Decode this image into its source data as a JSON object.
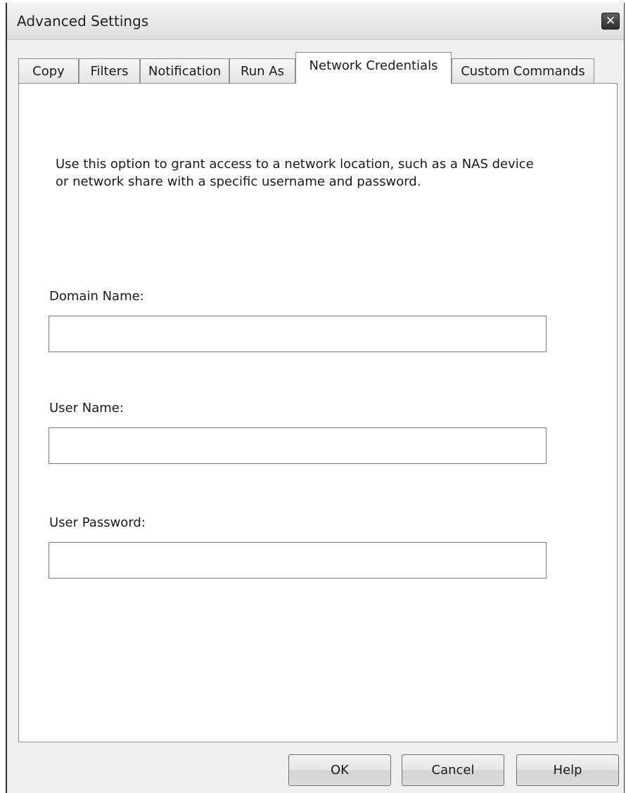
{
  "window": {
    "title": "Advanced Settings",
    "close_icon": "✕"
  },
  "tabs": [
    {
      "label": "Copy",
      "active": false
    },
    {
      "label": "Filters",
      "active": false
    },
    {
      "label": "Notification",
      "active": false
    },
    {
      "label": "Run As",
      "active": false
    },
    {
      "label": "Network Credentials",
      "active": true
    },
    {
      "label": "Custom Commands",
      "active": false
    }
  ],
  "panel": {
    "description": "Use this option to grant access to a network location, such as a NAS device or network share with a specific username and password.",
    "fields": {
      "domain": {
        "label": "Domain Name:",
        "value": ""
      },
      "user": {
        "label": "User Name:",
        "value": ""
      },
      "password": {
        "label": "User Password:",
        "value": ""
      }
    }
  },
  "buttons": {
    "ok": "OK",
    "cancel": "Cancel",
    "help": "Help"
  }
}
